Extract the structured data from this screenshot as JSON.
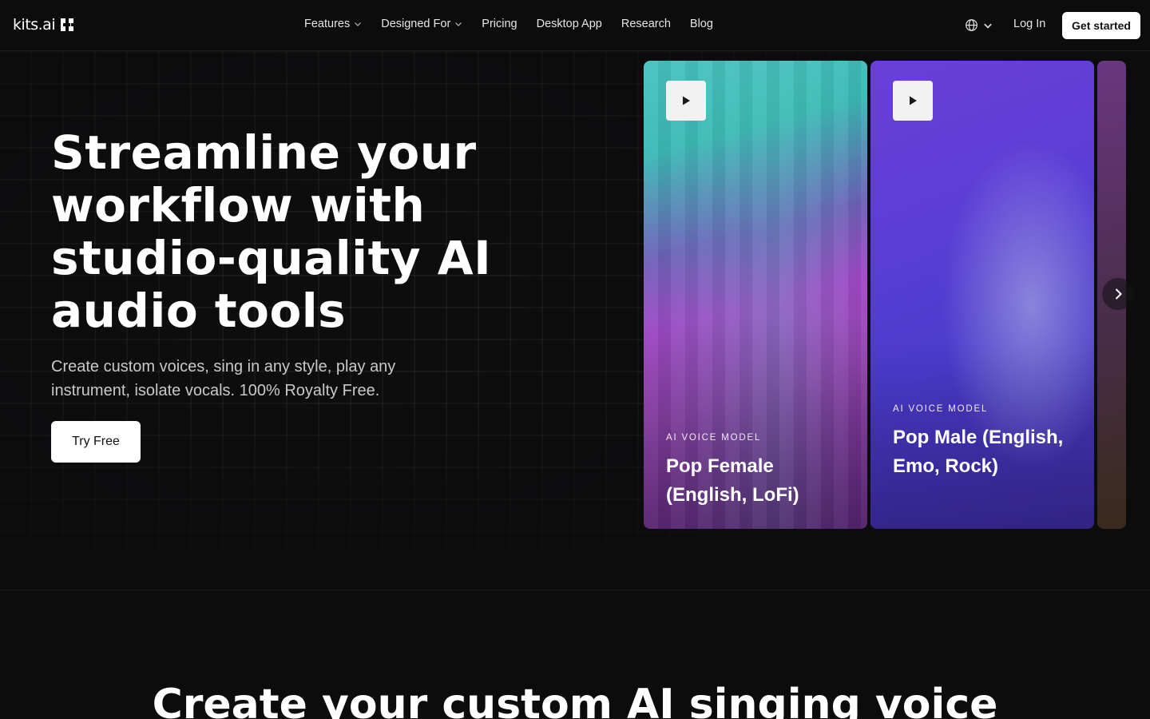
{
  "nav": {
    "logo_text": "kits.ai",
    "links": [
      {
        "label": "Features",
        "dropdown": true
      },
      {
        "label": "Designed For",
        "dropdown": true
      },
      {
        "label": "Pricing",
        "dropdown": false
      },
      {
        "label": "Desktop App",
        "dropdown": false
      },
      {
        "label": "Research",
        "dropdown": false
      },
      {
        "label": "Blog",
        "dropdown": false
      }
    ],
    "login_label": "Log In",
    "cta_label": "Get started",
    "language_icon": "globe-icon"
  },
  "hero": {
    "headline_lines": [
      "Streamline your",
      "workflow with",
      "studio-quality AI",
      "audio tools"
    ],
    "subtext": "Create custom voices, sing in any style, play any instrument, isolate vocals. 100% Royalty Free.",
    "cta_label": "Try Free"
  },
  "cards": [
    {
      "tag": "AI VOICE MODEL",
      "title": "Pop Female (English, LoFi)"
    },
    {
      "tag": "AI VOICE MODEL",
      "title": "Pop Male (English, Emo, Rock)"
    }
  ],
  "section": {
    "title": "Create your custom AI singing voice"
  },
  "colors": {
    "background": "#0c0c0d",
    "cta_bg": "#ffffff",
    "text_muted": "#c9c9cc"
  }
}
